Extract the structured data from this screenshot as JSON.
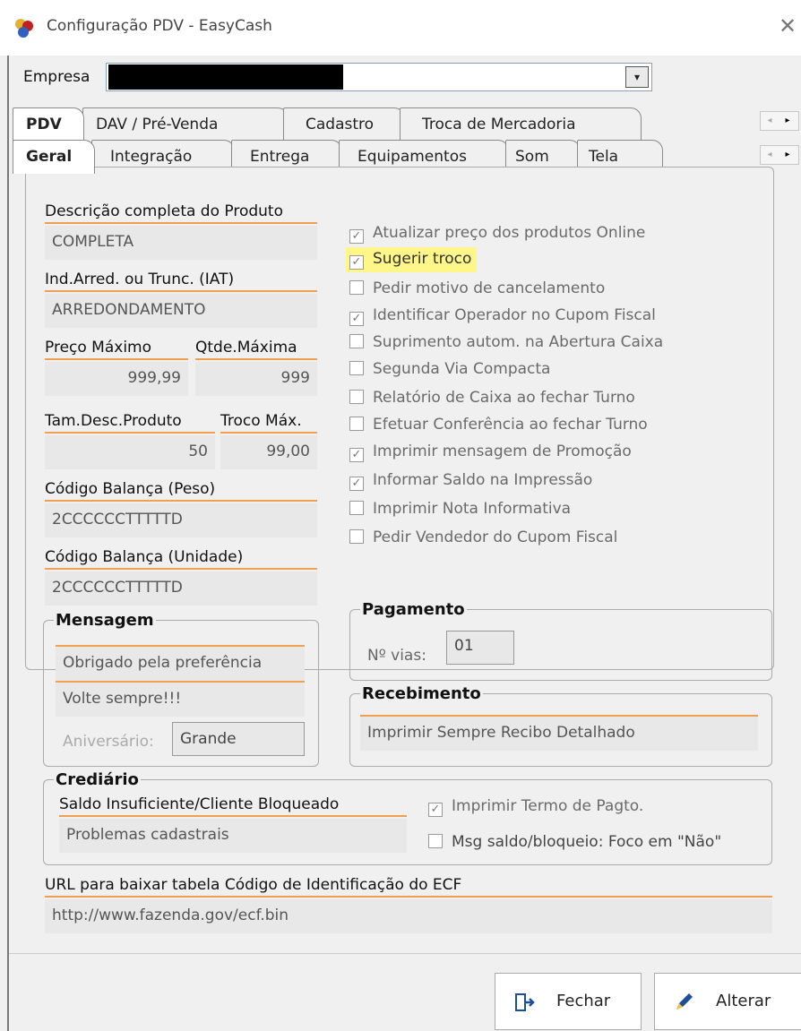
{
  "window": {
    "title": "Configuração PDV - EasyCash",
    "close_glyph": "✕",
    "app_icon": "easycash-app-icon"
  },
  "empresa": {
    "label": "Empresa",
    "value_redacted": true
  },
  "tabs_top": [
    {
      "label": "PDV",
      "active": true
    },
    {
      "label": "DAV / Pré-Venda"
    },
    {
      "label": "Cadastro"
    },
    {
      "label": "Troca de Mercadoria"
    }
  ],
  "tabs_sub": [
    {
      "label": "Geral",
      "active": true
    },
    {
      "label": "Integração"
    },
    {
      "label": "Entrega"
    },
    {
      "label": "Equipamentos"
    },
    {
      "label": "Som"
    },
    {
      "label": "Tela"
    }
  ],
  "left": {
    "desc_label": "Descrição completa do Produto",
    "desc_value": "COMPLETA",
    "iat_label": "Ind.Arred. ou Trunc. (IAT)",
    "iat_value": "ARREDONDAMENTO",
    "preco_label": "Preço Máximo",
    "preco_value": "999,99",
    "qtde_label": "Qtde.Máxima",
    "qtde_value": "999",
    "tamdesc_label": "Tam.Desc.Produto",
    "tamdesc_value": "50",
    "troco_label": "Troco Máx.",
    "troco_value": "99,00",
    "balpeso_label": "Código Balança (Peso)",
    "balpeso_value": "2CCCCCCTTTTTD",
    "balunid_label": "Código Balança (Unidade)",
    "balunid_value": "2CCCCCCTTTTTD"
  },
  "checks": [
    {
      "label": "Atualizar preço dos produtos Online",
      "checked": true
    },
    {
      "label": "Sugerir troco",
      "checked": true,
      "highlight": true
    },
    {
      "label": "Pedir motivo de cancelamento",
      "checked": false
    },
    {
      "label": "Identificar Operador no Cupom Fiscal",
      "checked": true
    },
    {
      "label": "Suprimento autom. na Abertura Caixa",
      "checked": false
    },
    {
      "label": "Segunda Via Compacta",
      "checked": false
    },
    {
      "label": "Relatório de Caixa ao fechar Turno",
      "checked": false
    },
    {
      "label": "Efetuar Conferência ao fechar Turno",
      "checked": false
    },
    {
      "label": "Imprimir mensagem de Promoção",
      "checked": true
    },
    {
      "label": "Informar Saldo na Impressão",
      "checked": true
    },
    {
      "label": "Imprimir Nota Informativa",
      "checked": false
    },
    {
      "label": "Pedir Vendedor do Cupom Fiscal",
      "checked": false
    }
  ],
  "mensagem": {
    "title": "Mensagem",
    "line1": "Obrigado pela preferência",
    "line2": "Volte sempre!!!",
    "aniv_label": "Aniversário:",
    "aniv_value": "Grande"
  },
  "pagamento": {
    "title": "Pagamento",
    "vias_label": "Nº vias:",
    "vias_value": "01"
  },
  "recebimento": {
    "title": "Recebimento",
    "value": "Imprimir Sempre Recibo Detalhado"
  },
  "crediario": {
    "title": "Crediário",
    "label": "Saldo Insuficiente/Cliente Bloqueado",
    "value": "Problemas cadastrais",
    "chk1": "Imprimir Termo de Pagto.",
    "chk1_checked": true,
    "chk2": "Msg saldo/bloqueio: Foco em \"Não\"",
    "chk2_checked": false
  },
  "url": {
    "label": "URL para baixar tabela Código de Identificação do ECF",
    "value": "http://www.fazenda.gov/ecf.bin"
  },
  "buttons": {
    "fechar": "Fechar",
    "alterar": "Alterar"
  },
  "glyphs": {
    "check": "✓",
    "dropdown": "▾",
    "left": "◂",
    "right": "▸"
  }
}
